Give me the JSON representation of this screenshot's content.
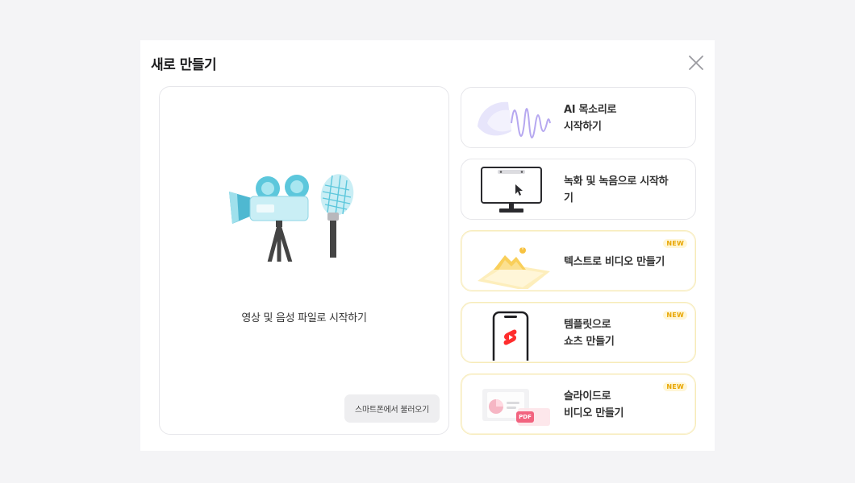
{
  "dialog": {
    "title": "새로 만들기"
  },
  "main_option": {
    "label": "영상 및 음성 파일로 시작하기",
    "phone_button_label": "스마트폰에서 불러오기"
  },
  "options": [
    {
      "line1": "AI 목소리로",
      "line2": "시작하기",
      "badge": ""
    },
    {
      "line1": "녹화 및 녹음으로 시작하",
      "line2": "기",
      "badge": ""
    },
    {
      "line1": "텍스트로 비디오 만들기",
      "line2": "",
      "badge": "NEW"
    },
    {
      "line1": "템플릿으로",
      "line2": "쇼츠 만들기",
      "badge": "NEW"
    },
    {
      "line1": "슬라이드로",
      "line2": "비디오 만들기",
      "badge": "NEW"
    }
  ],
  "pdf_icon_text": "PDF",
  "colors": {
    "accent_camera": "#5cc7dc",
    "badge_text": "#e8a600",
    "badge_bg": "#fff6d6",
    "shorts_red": "#ff2d2d"
  }
}
